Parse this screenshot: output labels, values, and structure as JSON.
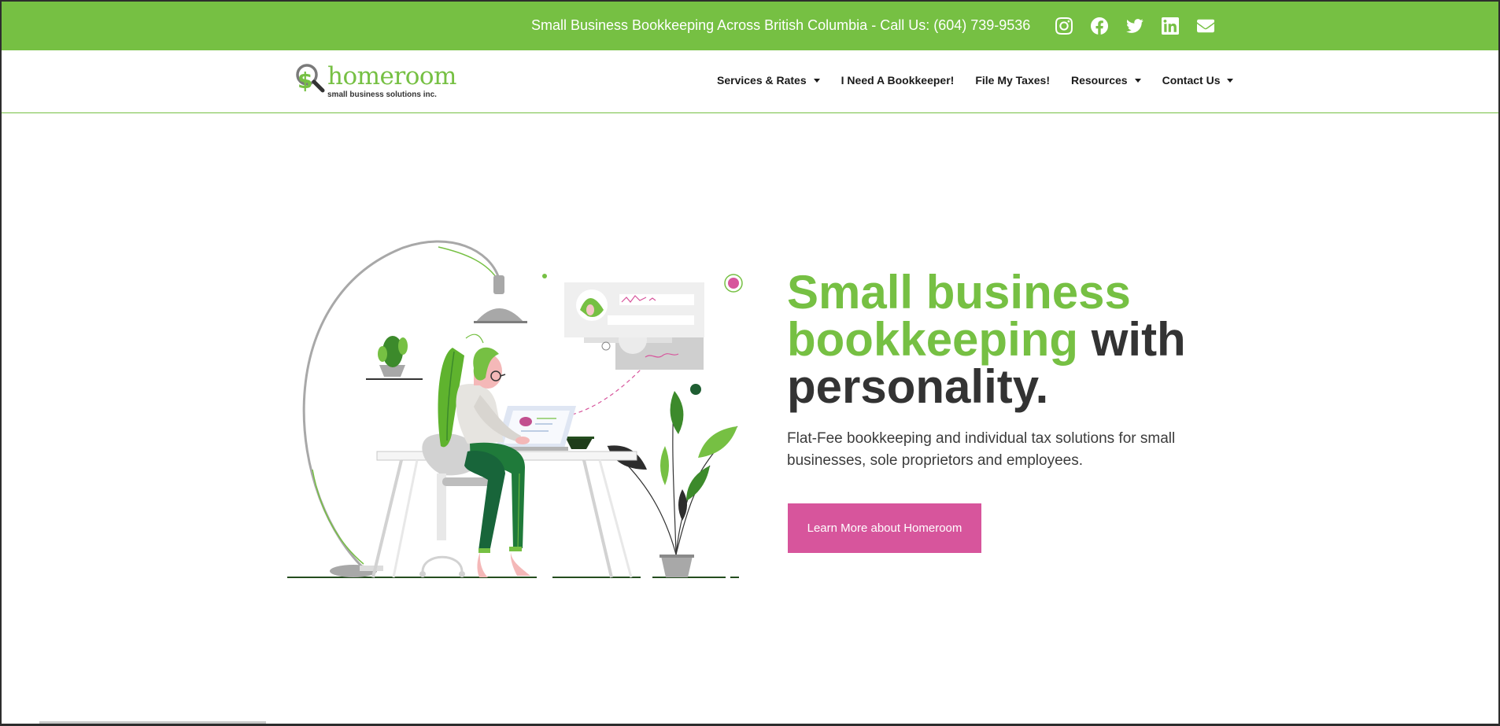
{
  "topbar": {
    "text": "Small Business Bookkeeping Across British Columbia - Call Us: (604) 739-9536",
    "socials": [
      {
        "name": "instagram-icon"
      },
      {
        "name": "facebook-icon"
      },
      {
        "name": "twitter-icon"
      },
      {
        "name": "linkedin-icon"
      },
      {
        "name": "envelope-icon"
      }
    ]
  },
  "logo": {
    "wordmark": "homeroom",
    "tagline": "small business solutions inc."
  },
  "nav": {
    "services": "Services & Rates",
    "bookkeeper": "I Need A Bookkeeper!",
    "taxes": "File My Taxes!",
    "resources": "Resources",
    "contact": "Contact Us"
  },
  "hero": {
    "headline_green": "Small business bookkeeping",
    "headline_dark_1": "with",
    "headline_dark_2": "personality.",
    "subtext": "Flat-Fee bookkeeping and individual tax solutions for small businesses, sole proprietors and employees.",
    "cta_label": "Learn More about Homeroom"
  },
  "colors": {
    "brand_green": "#76c043",
    "accent_pink": "#d7559c",
    "dark_text": "#333333"
  }
}
